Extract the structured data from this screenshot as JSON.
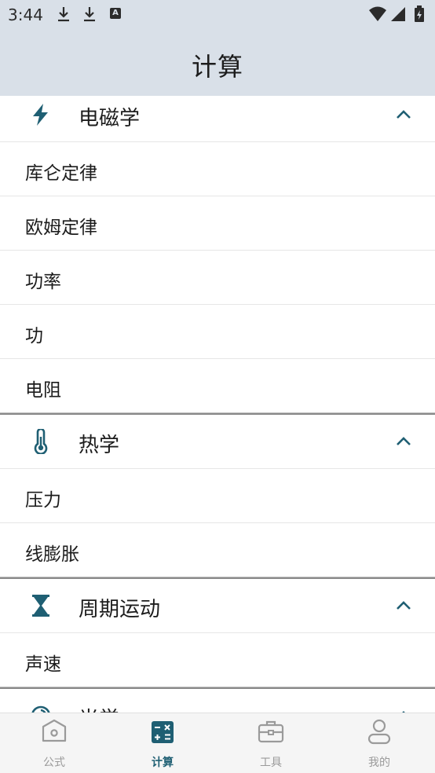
{
  "status_bar": {
    "time": "3:44",
    "badge": "A"
  },
  "app_bar": {
    "title": "计算"
  },
  "sections": [
    {
      "label": "电磁学",
      "icon": "lightning-icon",
      "items": [
        "库仑定律",
        "欧姆定律",
        "功率",
        "功",
        "电阻"
      ]
    },
    {
      "label": "热学",
      "icon": "thermometer-icon",
      "items": [
        "压力",
        "线膨胀"
      ]
    },
    {
      "label": "周期运动",
      "icon": "hourglass-icon",
      "items": [
        "声速"
      ]
    },
    {
      "label": "光学",
      "icon": "optics-icon",
      "items": []
    }
  ],
  "bottom_nav": [
    {
      "label": "公式",
      "icon": "formula-icon",
      "active": false
    },
    {
      "label": "计算",
      "icon": "calculator-icon",
      "active": true
    },
    {
      "label": "工具",
      "icon": "toolbox-icon",
      "active": false
    },
    {
      "label": "我的",
      "icon": "profile-icon",
      "active": false
    }
  ],
  "colors": {
    "accent": "#1f5f73",
    "app_bar_bg": "#d9e0e8",
    "inactive": "#9a9a9a"
  }
}
